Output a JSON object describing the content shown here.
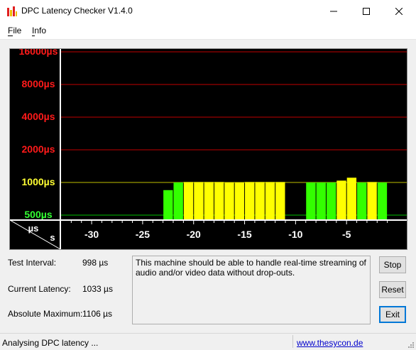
{
  "window": {
    "title": "DPC Latency Checker V1.4.0"
  },
  "menu": {
    "file": "File",
    "info": "Info"
  },
  "chart_data": {
    "type": "bar",
    "y_tick_labels": [
      {
        "label": "16000µs",
        "value": 16000,
        "color": "#ff1a1a"
      },
      {
        "label": "8000µs",
        "value": 8000,
        "color": "#ff1a1a"
      },
      {
        "label": "4000µs",
        "value": 4000,
        "color": "#ff1a1a"
      },
      {
        "label": "2000µs",
        "value": 2000,
        "color": "#ff1a1a"
      },
      {
        "label": "1000µs",
        "value": 1000,
        "color": "#ffff33"
      },
      {
        "label": "500µs",
        "value": 500,
        "color": "#33ff33"
      }
    ],
    "axis_unit_y": "µs",
    "axis_unit_x": "s",
    "x_tick_labels": [
      "-30",
      "-25",
      "-20",
      "-15",
      "-10",
      "-5"
    ],
    "x_ticks": [
      -30,
      -25,
      -20,
      -15,
      -10,
      -5
    ],
    "x_range": [
      -33,
      0
    ],
    "bar_colors": {
      "green": "#33ff00",
      "yellow": "#ffff00"
    },
    "bars": [
      {
        "t": -32.5,
        "v": 120,
        "c": "green"
      },
      {
        "t": -31.5,
        "v": 100,
        "c": "green"
      },
      {
        "t": -30.5,
        "v": 100,
        "c": "green"
      },
      {
        "t": -29.5,
        "v": 100,
        "c": "green"
      },
      {
        "t": -28.5,
        "v": 100,
        "c": "green"
      },
      {
        "t": -27.5,
        "v": 120,
        "c": "green"
      },
      {
        "t": -26.5,
        "v": 100,
        "c": "green"
      },
      {
        "t": -25.5,
        "v": 100,
        "c": "green"
      },
      {
        "t": -24.5,
        "v": 100,
        "c": "green"
      },
      {
        "t": -23.5,
        "v": 100,
        "c": "green"
      },
      {
        "t": -22.5,
        "v": 850,
        "c": "green"
      },
      {
        "t": -21.5,
        "v": 1000,
        "c": "green"
      },
      {
        "t": -20.5,
        "v": 1010,
        "c": "yellow"
      },
      {
        "t": -19.5,
        "v": 1010,
        "c": "yellow"
      },
      {
        "t": -18.5,
        "v": 1010,
        "c": "yellow"
      },
      {
        "t": -17.5,
        "v": 1010,
        "c": "yellow"
      },
      {
        "t": -16.5,
        "v": 1000,
        "c": "yellow"
      },
      {
        "t": -15.5,
        "v": 1000,
        "c": "yellow"
      },
      {
        "t": -14.5,
        "v": 1010,
        "c": "yellow"
      },
      {
        "t": -13.5,
        "v": 1010,
        "c": "yellow"
      },
      {
        "t": -12.5,
        "v": 1010,
        "c": "yellow"
      },
      {
        "t": -11.5,
        "v": 1010,
        "c": "yellow"
      },
      {
        "t": -10.5,
        "v": 100,
        "c": "green"
      },
      {
        "t": -9.5,
        "v": 100,
        "c": "green"
      },
      {
        "t": -8.5,
        "v": 1000,
        "c": "green"
      },
      {
        "t": -7.5,
        "v": 1000,
        "c": "green"
      },
      {
        "t": -6.5,
        "v": 1000,
        "c": "green"
      },
      {
        "t": -5.5,
        "v": 1040,
        "c": "yellow"
      },
      {
        "t": -4.5,
        "v": 1106,
        "c": "yellow"
      },
      {
        "t": -3.5,
        "v": 1000,
        "c": "green"
      },
      {
        "t": -2.5,
        "v": 1010,
        "c": "yellow"
      },
      {
        "t": -1.5,
        "v": 1000,
        "c": "green"
      }
    ]
  },
  "stats": {
    "test_interval_label": "Test Interval:",
    "test_interval_value": "998 µs",
    "current_latency_label": "Current Latency:",
    "current_latency_value": "1033 µs",
    "absolute_max_label": "Absolute Maximum:",
    "absolute_max_value": "1106 µs"
  },
  "message": "This machine should be able to handle real-time streaming of audio and/or video data without drop-outs.",
  "buttons": {
    "stop": "Stop",
    "reset": "Reset",
    "exit": "Exit"
  },
  "status": {
    "text": "Analysing DPC latency ...",
    "link": "www.thesycon.de"
  },
  "colors": {
    "grid_line": "#c00000",
    "chart_bg": "#000000",
    "white_axis": "#ffffff"
  }
}
